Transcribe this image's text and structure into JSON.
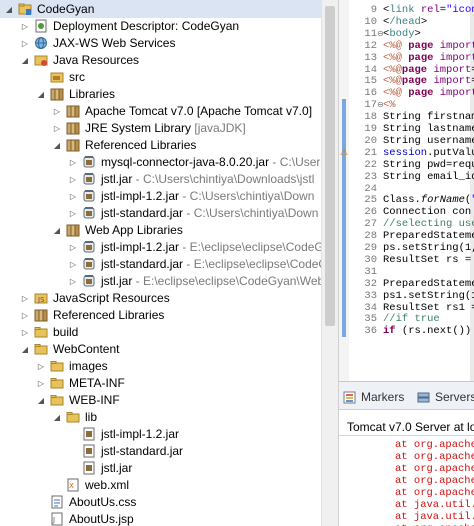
{
  "explorer": {
    "items": [
      {
        "label": "CodeGyan",
        "arrow": "open",
        "icon": "project-icon"
      },
      {
        "label": "Deployment Descriptor: CodeGyan",
        "arrow": "closed",
        "icon": "deployment-descriptor-icon"
      },
      {
        "label": "JAX-WS Web Services",
        "arrow": "closed",
        "icon": "web-services-icon"
      },
      {
        "label": "Java Resources",
        "arrow": "open",
        "icon": "java-resources-icon"
      },
      {
        "label": "src",
        "arrow": "none",
        "icon": "source-folder-icon"
      },
      {
        "label": "Libraries",
        "arrow": "open",
        "icon": "libraries-icon"
      },
      {
        "label": "Apache Tomcat v7.0 [Apache Tomcat v7.0]",
        "arrow": "closed",
        "icon": "library-icon"
      },
      {
        "label": "JRE System Library",
        "dim": "[javaJDK]",
        "arrow": "closed",
        "icon": "library-icon"
      },
      {
        "label": "Referenced Libraries",
        "arrow": "open",
        "icon": "library-icon"
      },
      {
        "label": "mysql-connector-java-8.0.20.jar",
        "dim": " - C:\\Users",
        "arrow": "closed",
        "icon": "jar-icon"
      },
      {
        "label": "jstl.jar",
        "dim": " - C:\\Users\\chintiya\\Downloads\\jstl",
        "arrow": "closed",
        "icon": "jar-icon"
      },
      {
        "label": "jstl-impl-1.2.jar",
        "dim": " - C:\\Users\\chintiya\\Down",
        "arrow": "closed",
        "icon": "jar-icon"
      },
      {
        "label": "jstl-standard.jar",
        "dim": " - C:\\Users\\chintiya\\Down",
        "arrow": "closed",
        "icon": "jar-icon"
      },
      {
        "label": "Web App Libraries",
        "arrow": "open",
        "icon": "library-icon"
      },
      {
        "label": "jstl-impl-1.2.jar",
        "dim": " - E:\\eclipse\\eclipse\\CodeG",
        "arrow": "closed",
        "icon": "jar-icon"
      },
      {
        "label": "jstl-standard.jar",
        "dim": " - E:\\eclipse\\eclipse\\CodeGy",
        "arrow": "closed",
        "icon": "jar-icon"
      },
      {
        "label": "jstl.jar",
        "dim": " - E:\\eclipse\\eclipse\\CodeGyan\\Web",
        "arrow": "closed",
        "icon": "jar-icon"
      },
      {
        "label": "JavaScript Resources",
        "arrow": "closed",
        "icon": "javascript-resources-icon"
      },
      {
        "label": "Referenced Libraries",
        "arrow": "closed",
        "icon": "library-icon"
      },
      {
        "label": "build",
        "arrow": "closed",
        "icon": "folder-icon"
      },
      {
        "label": "WebContent",
        "arrow": "open",
        "icon": "folder-icon"
      },
      {
        "label": "images",
        "arrow": "closed",
        "icon": "folder-icon"
      },
      {
        "label": "META-INF",
        "arrow": "closed",
        "icon": "folder-icon"
      },
      {
        "label": "WEB-INF",
        "arrow": "open",
        "icon": "folder-icon"
      },
      {
        "label": "lib",
        "arrow": "open",
        "icon": "folder-icon"
      },
      {
        "label": "jstl-impl-1.2.jar",
        "arrow": "none",
        "icon": "jar-file-icon"
      },
      {
        "label": "jstl-standard.jar",
        "arrow": "none",
        "icon": "jar-file-icon"
      },
      {
        "label": "jstl.jar",
        "arrow": "none",
        "icon": "jar-file-icon"
      },
      {
        "label": "web.xml",
        "arrow": "none",
        "icon": "xml-file-icon"
      },
      {
        "label": "AboutUs.css",
        "arrow": "none",
        "icon": "css-file-icon"
      },
      {
        "label": "AboutUs.jsp",
        "arrow": "none",
        "icon": "jsp-file-icon"
      }
    ]
  },
  "editor": {
    "lines": [
      {
        "n": "9",
        "fold": "",
        "text": "<link rel=\"icon\""
      },
      {
        "n": "10",
        "fold": "",
        "text": "</head>"
      },
      {
        "n": "11",
        "fold": "⊖",
        "text": "<body>"
      },
      {
        "n": "12",
        "fold": "",
        "text": "<%@ page import="
      },
      {
        "n": "13",
        "fold": "",
        "text": "<%@ page import="
      },
      {
        "n": "14",
        "fold": "",
        "text": "<%@page import=\""
      },
      {
        "n": "15",
        "fold": "",
        "text": "<%@page import=\""
      },
      {
        "n": "16",
        "fold": "",
        "text": "<%@ page import="
      },
      {
        "n": "17",
        "fold": "⊖",
        "text": "<%"
      },
      {
        "n": "18",
        "fold": "",
        "text": "String firstname="
      },
      {
        "n": "19",
        "fold": "",
        "text": "String lastname="
      },
      {
        "n": "20",
        "fold": "",
        "text": "String username="
      },
      {
        "n": "21",
        "fold": "",
        "text": "session.putValue"
      },
      {
        "n": "22",
        "fold": "",
        "text": "String pwd=reque"
      },
      {
        "n": "23",
        "fold": "",
        "text": "String email_id="
      },
      {
        "n": "24",
        "fold": "",
        "text": ""
      },
      {
        "n": "25",
        "fold": "",
        "text": "Class.forName(\"co"
      },
      {
        "n": "26",
        "fold": "",
        "text": "Connection con ="
      },
      {
        "n": "27",
        "fold": "",
        "text": "//selecting user"
      },
      {
        "n": "28",
        "fold": "",
        "text": "PreparedStatement"
      },
      {
        "n": "29",
        "fold": "",
        "text": "ps.setString(1, u"
      },
      {
        "n": "30",
        "fold": "",
        "text": "ResultSet rs = ps"
      },
      {
        "n": "31",
        "fold": "",
        "text": ""
      },
      {
        "n": "32",
        "fold": "",
        "text": "PreparedStatement"
      },
      {
        "n": "33",
        "fold": "",
        "text": "ps1.setString(1,"
      },
      {
        "n": "34",
        "fold": "",
        "text": "ResultSet rs1 ="
      },
      {
        "n": "35",
        "fold": "",
        "text": "//if true"
      },
      {
        "n": "36",
        "fold": "",
        "text": "if (rs.next()) {"
      }
    ]
  },
  "views": {
    "tabs": [
      {
        "label": "Markers",
        "icon": "markers-icon"
      },
      {
        "label": "Servers",
        "icon": "servers-icon"
      }
    ],
    "console_title": "Tomcat v7.0 Server at loca",
    "trace": [
      "at org.apache.",
      "at org.apache.",
      "at org.apache.",
      "at org.apache.",
      "at org.apache.",
      "at java.util.co",
      "at java.util.co",
      "at org.apache."
    ]
  },
  "colors": {
    "selection": "#dbe4f3",
    "folder": "#e8c25a",
    "jar": "#8a6d3b",
    "trace_text": "#d01010"
  }
}
